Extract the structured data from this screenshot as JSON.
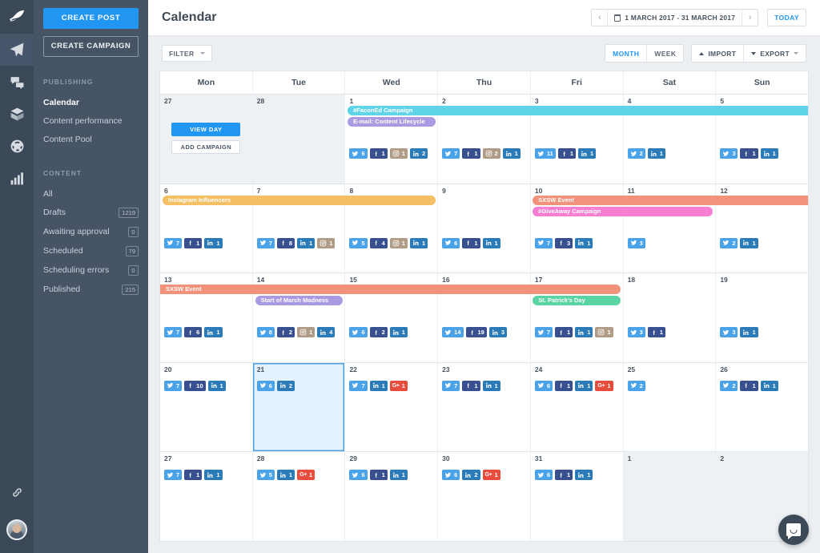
{
  "rail": {
    "items": [
      {
        "name": "brand-logo",
        "icon": "feather-icon"
      },
      {
        "name": "publish",
        "icon": "paper-plane-icon",
        "active": true
      },
      {
        "name": "engage",
        "icon": "chat-bubbles-icon"
      },
      {
        "name": "assets",
        "icon": "box-icon"
      },
      {
        "name": "listen",
        "icon": "globe-icon"
      },
      {
        "name": "analytics",
        "icon": "bar-chart-icon"
      }
    ],
    "link_icon": "link-icon",
    "avatar": "user-avatar"
  },
  "sidebar": {
    "create_post_label": "CREATE POST",
    "create_campaign_label": "CREATE CAMPAIGN",
    "sections": [
      {
        "title": "PUBLISHING",
        "items": [
          {
            "label": "Calendar",
            "active": true
          },
          {
            "label": "Content performance"
          },
          {
            "label": "Content Pool"
          }
        ]
      },
      {
        "title": "CONTENT",
        "items": [
          {
            "label": "All"
          },
          {
            "label": "Drafts",
            "count": "1219"
          },
          {
            "label": "Awaiting approval",
            "count": "0"
          },
          {
            "label": "Scheduled",
            "count": "79"
          },
          {
            "label": "Scheduling errors",
            "count": "0"
          },
          {
            "label": "Published",
            "count": "215"
          }
        ]
      }
    ]
  },
  "header": {
    "title": "Calendar",
    "date_range": "1 MARCH 2017 - 31 MARCH 2017",
    "prev_label": "‹",
    "next_label": "›",
    "today_label": "TODAY"
  },
  "toolbar": {
    "filter_label": "FILTER",
    "month_label": "MONTH",
    "week_label": "WEEK",
    "import_label": "IMPORT",
    "export_label": "EXPORT"
  },
  "calendar": {
    "day_names": [
      "Mon",
      "Tue",
      "Wed",
      "Thu",
      "Fri",
      "Sat",
      "Sun"
    ],
    "day_cell_actions": {
      "view_day": "VIEW DAY",
      "add_campaign": "ADD CAMPAIGN"
    },
    "network_colors": {
      "twitter": "#4aa3e8",
      "facebook": "#38508f",
      "instagram": "#b09c86",
      "linkedin": "#2b7bb9",
      "googleplus": "#e74c3c"
    },
    "campaign_colors": {
      "faconed": "#5fd4e8",
      "email": "#a99ae2",
      "instagram_influencers": "#f5c064",
      "sxsw": "#f2927a",
      "giveaway": "#f77fd2",
      "march_madness": "#a99ae2",
      "patrick": "#5bd4a4"
    },
    "weeks": [
      {
        "days": [
          {
            "num": "27",
            "other": true,
            "actions": true
          },
          {
            "num": "28",
            "other": true
          },
          {
            "num": "1",
            "badges": [
              {
                "net": "twitter",
                "count": "6"
              },
              {
                "net": "facebook",
                "count": "1"
              },
              {
                "net": "instagram",
                "count": "1"
              },
              {
                "net": "linkedin",
                "count": "2"
              }
            ]
          },
          {
            "num": "2",
            "badges": [
              {
                "net": "twitter",
                "count": "7"
              },
              {
                "net": "facebook",
                "count": "1"
              },
              {
                "net": "instagram",
                "count": "2"
              },
              {
                "net": "linkedin",
                "count": "1"
              }
            ]
          },
          {
            "num": "3",
            "badges": [
              {
                "net": "twitter",
                "count": "11"
              },
              {
                "net": "facebook",
                "count": "1"
              },
              {
                "net": "linkedin",
                "count": "1"
              }
            ]
          },
          {
            "num": "4",
            "badges": [
              {
                "net": "twitter",
                "count": "2"
              },
              {
                "net": "linkedin",
                "count": "1"
              }
            ]
          },
          {
            "num": "5",
            "badges": [
              {
                "net": "twitter",
                "count": "3"
              },
              {
                "net": "facebook",
                "count": "1"
              },
              {
                "net": "linkedin",
                "count": "1"
              }
            ]
          }
        ],
        "pills": [
          {
            "label": "#FaconEd Campaign",
            "color_key": "faconed",
            "start": 2,
            "span": 5,
            "row": 0,
            "open_end": true
          },
          {
            "label": "E-mail: Content Lifecycle",
            "color_key": "email",
            "start": 2,
            "span": 1,
            "row": 1
          }
        ]
      },
      {
        "days": [
          {
            "num": "6",
            "badges": [
              {
                "net": "twitter",
                "count": "7"
              },
              {
                "net": "facebook",
                "count": "1"
              },
              {
                "net": "linkedin",
                "count": "1"
              }
            ]
          },
          {
            "num": "7",
            "badges": [
              {
                "net": "twitter",
                "count": "7"
              },
              {
                "net": "facebook",
                "count": "8"
              },
              {
                "net": "linkedin",
                "count": "1"
              },
              {
                "net": "instagram",
                "count": "1"
              }
            ]
          },
          {
            "num": "8",
            "badges": [
              {
                "net": "twitter",
                "count": "5"
              },
              {
                "net": "facebook",
                "count": "4"
              },
              {
                "net": "instagram",
                "count": "1"
              },
              {
                "net": "linkedin",
                "count": "1"
              }
            ]
          },
          {
            "num": "9",
            "badges": [
              {
                "net": "twitter",
                "count": "6"
              },
              {
                "net": "facebook",
                "count": "1"
              },
              {
                "net": "linkedin",
                "count": "1"
              }
            ]
          },
          {
            "num": "10",
            "badges": [
              {
                "net": "twitter",
                "count": "7"
              },
              {
                "net": "facebook",
                "count": "3"
              },
              {
                "net": "linkedin",
                "count": "1"
              }
            ]
          },
          {
            "num": "11",
            "badges": [
              {
                "net": "twitter",
                "count": "3"
              }
            ]
          },
          {
            "num": "12",
            "badges": [
              {
                "net": "twitter",
                "count": "2"
              },
              {
                "net": "linkedin",
                "count": "1"
              }
            ]
          }
        ],
        "pills": [
          {
            "label": "Instagram Influencers",
            "color_key": "instagram_influencers",
            "start": 0,
            "span": 3,
            "row": 0
          },
          {
            "label": "SXSW Event",
            "color_key": "sxsw",
            "start": 4,
            "span": 3,
            "row": 0,
            "open_end": true
          },
          {
            "label": "#GiveAway Campaign",
            "color_key": "giveaway",
            "start": 4,
            "span": 2,
            "row": 1
          }
        ]
      },
      {
        "days": [
          {
            "num": "13",
            "badges": [
              {
                "net": "twitter",
                "count": "7"
              },
              {
                "net": "facebook",
                "count": "6"
              },
              {
                "net": "linkedin",
                "count": "1"
              }
            ]
          },
          {
            "num": "14",
            "badges": [
              {
                "net": "twitter",
                "count": "8"
              },
              {
                "net": "facebook",
                "count": "2"
              },
              {
                "net": "instagram",
                "count": "1"
              },
              {
                "net": "linkedin",
                "count": "4"
              }
            ]
          },
          {
            "num": "15",
            "badges": [
              {
                "net": "twitter",
                "count": "6"
              },
              {
                "net": "facebook",
                "count": "2"
              },
              {
                "net": "linkedin",
                "count": "1"
              }
            ]
          },
          {
            "num": "16",
            "badges": [
              {
                "net": "twitter",
                "count": "14"
              },
              {
                "net": "facebook",
                "count": "19"
              },
              {
                "net": "linkedin",
                "count": "3"
              }
            ]
          },
          {
            "num": "17",
            "badges": [
              {
                "net": "twitter",
                "count": "7"
              },
              {
                "net": "facebook",
                "count": "1"
              },
              {
                "net": "linkedin",
                "count": "1"
              },
              {
                "net": "instagram",
                "count": "1"
              }
            ]
          },
          {
            "num": "18",
            "badges": [
              {
                "net": "twitter",
                "count": "3"
              },
              {
                "net": "facebook",
                "count": "1"
              }
            ]
          },
          {
            "num": "19",
            "badges": [
              {
                "net": "twitter",
                "count": "3"
              },
              {
                "net": "linkedin",
                "count": "1"
              }
            ]
          }
        ],
        "pills": [
          {
            "label": "SXSW Event",
            "color_key": "sxsw",
            "start": 0,
            "span": 5,
            "row": 0,
            "open_start": true
          },
          {
            "label": "Start of March Madness",
            "color_key": "march_madness",
            "start": 1,
            "span": 1,
            "row": 1
          },
          {
            "label": "St. Patrick's Day",
            "color_key": "patrick",
            "start": 4,
            "span": 1,
            "row": 1
          }
        ]
      },
      {
        "days": [
          {
            "num": "20",
            "badges": [
              {
                "net": "twitter",
                "count": "7"
              },
              {
                "net": "facebook",
                "count": "10"
              },
              {
                "net": "linkedin",
                "count": "1"
              }
            ]
          },
          {
            "num": "21",
            "today": true,
            "badges": [
              {
                "net": "twitter",
                "count": "6"
              },
              {
                "net": "linkedin",
                "count": "2"
              }
            ]
          },
          {
            "num": "22",
            "badges": [
              {
                "net": "twitter",
                "count": "7"
              },
              {
                "net": "linkedin",
                "count": "1"
              },
              {
                "net": "googleplus",
                "count": "1"
              }
            ]
          },
          {
            "num": "23",
            "badges": [
              {
                "net": "twitter",
                "count": "7"
              },
              {
                "net": "facebook",
                "count": "1"
              },
              {
                "net": "linkedin",
                "count": "1"
              }
            ]
          },
          {
            "num": "24",
            "badges": [
              {
                "net": "twitter",
                "count": "6"
              },
              {
                "net": "facebook",
                "count": "1"
              },
              {
                "net": "linkedin",
                "count": "1"
              },
              {
                "net": "googleplus",
                "count": "1"
              }
            ]
          },
          {
            "num": "25",
            "badges": [
              {
                "net": "twitter",
                "count": "2"
              }
            ]
          },
          {
            "num": "26",
            "badges": [
              {
                "net": "twitter",
                "count": "2"
              },
              {
                "net": "facebook",
                "count": "1"
              },
              {
                "net": "linkedin",
                "count": "1"
              }
            ]
          }
        ],
        "pills": []
      },
      {
        "days": [
          {
            "num": "27",
            "badges": [
              {
                "net": "twitter",
                "count": "7"
              },
              {
                "net": "facebook",
                "count": "1"
              },
              {
                "net": "linkedin",
                "count": "1"
              }
            ]
          },
          {
            "num": "28",
            "badges": [
              {
                "net": "twitter",
                "count": "5"
              },
              {
                "net": "linkedin",
                "count": "1"
              },
              {
                "net": "googleplus",
                "count": "1"
              }
            ]
          },
          {
            "num": "29",
            "badges": [
              {
                "net": "twitter",
                "count": "6"
              },
              {
                "net": "facebook",
                "count": "1"
              },
              {
                "net": "linkedin",
                "count": "1"
              }
            ]
          },
          {
            "num": "30",
            "badges": [
              {
                "net": "twitter",
                "count": "6"
              },
              {
                "net": "linkedin",
                "count": "2"
              },
              {
                "net": "googleplus",
                "count": "1"
              }
            ]
          },
          {
            "num": "31",
            "badges": [
              {
                "net": "twitter",
                "count": "6"
              },
              {
                "net": "facebook",
                "count": "1"
              },
              {
                "net": "linkedin",
                "count": "1"
              }
            ]
          },
          {
            "num": "1",
            "other": true
          },
          {
            "num": "2",
            "other": true
          }
        ],
        "pills": []
      }
    ]
  },
  "chat": {
    "icon": "chat-launcher-icon"
  }
}
